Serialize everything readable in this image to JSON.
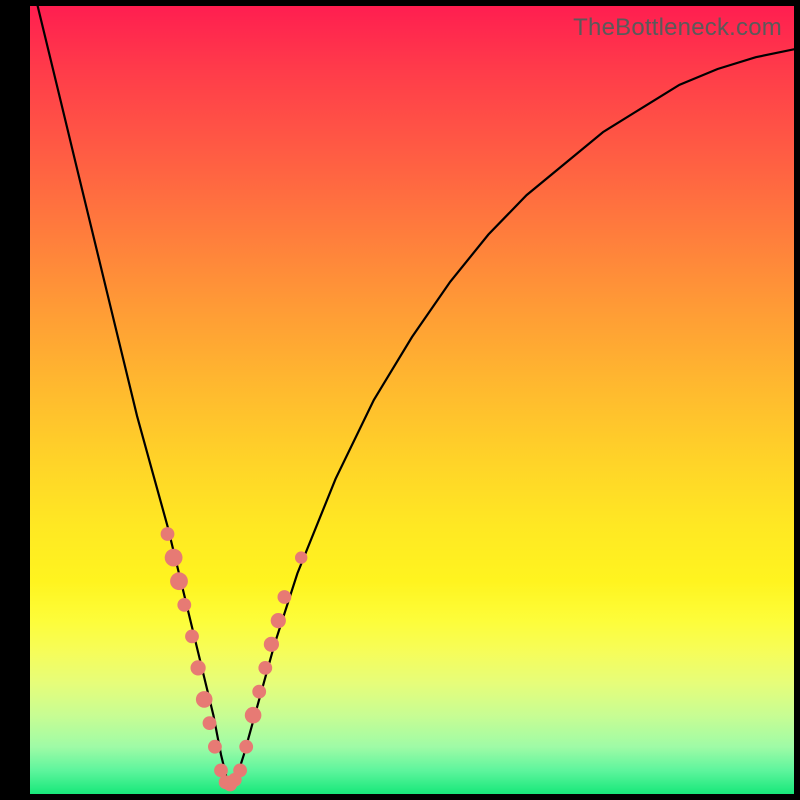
{
  "watermark": "TheBottleneck.com",
  "colors": {
    "background": "#000000",
    "curve": "#000000",
    "dot": "#e77a74",
    "gradient_top": "#ff1e50",
    "gradient_bottom": "#17e87a"
  },
  "chart_data": {
    "type": "line",
    "title": "",
    "xlabel": "",
    "ylabel": "",
    "xlim": [
      0,
      100
    ],
    "ylim": [
      0,
      100
    ],
    "notes": "No axes or ticks shown. x interpreted as 0–100 across plot width, y as 0 (bottom/green) to 100 (top/red). Curve is a V-shaped bottleneck curve with minimum near x≈26.",
    "series": [
      {
        "name": "bottleneck-curve",
        "x": [
          0,
          2,
          4,
          6,
          8,
          10,
          12,
          14,
          16,
          18,
          20,
          22,
          24,
          25,
          26,
          27,
          28,
          30,
          32,
          35,
          40,
          45,
          50,
          55,
          60,
          65,
          70,
          75,
          80,
          85,
          90,
          95,
          100
        ],
        "y": [
          104,
          96,
          88,
          80,
          72,
          64,
          56,
          48,
          41,
          34,
          26,
          18,
          10,
          5,
          1,
          2,
          5,
          12,
          19,
          28,
          40,
          50,
          58,
          65,
          71,
          76,
          80,
          84,
          87,
          90,
          92,
          93.5,
          94.5
        ]
      }
    ],
    "points": [
      {
        "name": "dot",
        "x": 18.0,
        "y": 33,
        "r": 1.0
      },
      {
        "name": "dot",
        "x": 18.8,
        "y": 30,
        "r": 1.3
      },
      {
        "name": "dot",
        "x": 19.5,
        "y": 27,
        "r": 1.3
      },
      {
        "name": "dot",
        "x": 20.2,
        "y": 24,
        "r": 1.0
      },
      {
        "name": "dot",
        "x": 21.2,
        "y": 20,
        "r": 1.0
      },
      {
        "name": "dot",
        "x": 22.0,
        "y": 16,
        "r": 1.1
      },
      {
        "name": "dot",
        "x": 22.8,
        "y": 12,
        "r": 1.2
      },
      {
        "name": "dot",
        "x": 23.5,
        "y": 9,
        "r": 1.0
      },
      {
        "name": "dot",
        "x": 24.2,
        "y": 6,
        "r": 1.0
      },
      {
        "name": "dot",
        "x": 25.0,
        "y": 3,
        "r": 1.0
      },
      {
        "name": "dot",
        "x": 25.6,
        "y": 1.5,
        "r": 1.0
      },
      {
        "name": "dot",
        "x": 26.2,
        "y": 1.2,
        "r": 1.0
      },
      {
        "name": "dot",
        "x": 26.8,
        "y": 1.8,
        "r": 1.0
      },
      {
        "name": "dot",
        "x": 27.5,
        "y": 3,
        "r": 1.0
      },
      {
        "name": "dot",
        "x": 28.3,
        "y": 6,
        "r": 1.0
      },
      {
        "name": "dot",
        "x": 29.2,
        "y": 10,
        "r": 1.2
      },
      {
        "name": "dot",
        "x": 30.0,
        "y": 13,
        "r": 1.0
      },
      {
        "name": "dot",
        "x": 30.8,
        "y": 16,
        "r": 1.0
      },
      {
        "name": "dot",
        "x": 31.6,
        "y": 19,
        "r": 1.1
      },
      {
        "name": "dot",
        "x": 32.5,
        "y": 22,
        "r": 1.1
      },
      {
        "name": "dot",
        "x": 33.3,
        "y": 25,
        "r": 1.0
      },
      {
        "name": "dot",
        "x": 35.5,
        "y": 30,
        "r": 0.9
      }
    ]
  }
}
